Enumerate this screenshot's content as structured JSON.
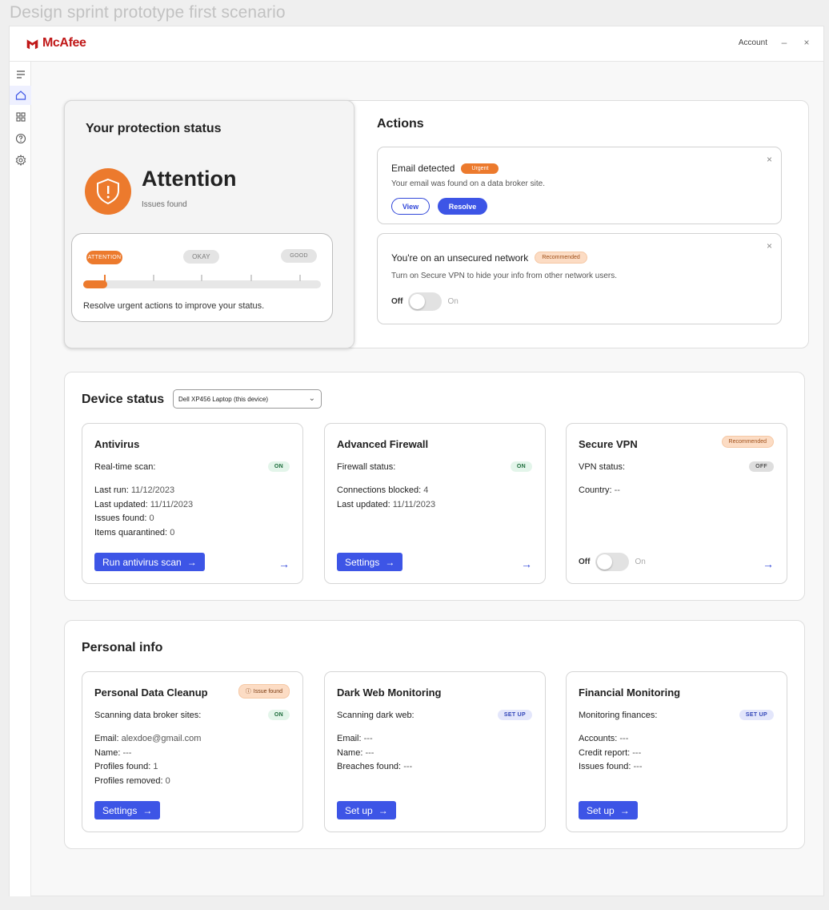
{
  "canvas_label": "Design sprint prototype first scenario",
  "titlebar": {
    "brand": "McAfee",
    "account": "Account",
    "minimize": "–",
    "close": "×"
  },
  "colors": {
    "brand": "#c01818",
    "accent": "#3d55e6",
    "attention": "#ec7a2d"
  },
  "protection": {
    "title": "Your protection status",
    "status": "Attention",
    "subtitle": "Issues found",
    "scale": {
      "labels": [
        "ATTENTION",
        "OKAY",
        "GOOD"
      ],
      "level_fraction": 0.1
    },
    "note": "Resolve urgent actions to improve your status."
  },
  "actions": {
    "title": "Actions",
    "items": [
      {
        "title": "Email detected",
        "badge": "Urgent",
        "desc": "Your email was found on a data broker site.",
        "view": "View",
        "resolve": "Resolve"
      },
      {
        "title": "You're on an unsecured network",
        "badge": "Recommended",
        "desc": "Turn on Secure VPN to hide your info from other network users.",
        "toggle_off": "Off",
        "toggle_on": "On"
      }
    ]
  },
  "device_status": {
    "title": "Device status",
    "selected_device": "Dell XP456 Laptop (this device)",
    "cards": [
      {
        "title": "Antivirus",
        "status_label": "Real-time scan:",
        "status": "ON",
        "lines": [
          {
            "k": "Last run:",
            "v": "11/12/2023"
          },
          {
            "k": "Last updated:",
            "v": "11/11/2023"
          },
          {
            "k": "Issues found:",
            "v": "0"
          },
          {
            "k": "Items quarantined:",
            "v": "0"
          }
        ],
        "button": "Run antivirus scan"
      },
      {
        "title": "Advanced Firewall",
        "status_label": "Firewall status:",
        "status": "ON",
        "lines": [
          {
            "k": "Connections blocked:",
            "v": "4"
          },
          {
            "k": "Last updated:",
            "v": "11/11/2023"
          }
        ],
        "button": "Settings"
      },
      {
        "title": "Secure VPN",
        "badge": "Recommended",
        "status_label": "VPN status:",
        "status": "OFF",
        "lines": [
          {
            "k": "Country:",
            "v": "--"
          }
        ],
        "toggle_off": "Off",
        "toggle_on": "On"
      }
    ]
  },
  "personal_info": {
    "title": "Personal info",
    "cards": [
      {
        "title": "Personal Data Cleanup",
        "badge": "Issue found",
        "status_label": "Scanning data broker sites:",
        "status": "ON",
        "lines": [
          {
            "k": "Email:",
            "v": "alexdoe@gmail.com"
          },
          {
            "k": "Name:",
            "v": "---"
          },
          {
            "k": "Profiles found:",
            "v": "1"
          },
          {
            "k": "Profiles removed:",
            "v": "0"
          }
        ],
        "button": "Settings"
      },
      {
        "title": "Dark Web Monitoring",
        "status_label": "Scanning dark web:",
        "status": "SET UP",
        "lines": [
          {
            "k": "Email:",
            "v": "---"
          },
          {
            "k": "Name:",
            "v": "---"
          },
          {
            "k": "Breaches found:",
            "v": "---"
          }
        ],
        "button": "Set up"
      },
      {
        "title": "Financial Monitoring",
        "status_label": "Monitoring finances:",
        "status": "SET UP",
        "lines": [
          {
            "k": "Accounts:",
            "v": "---"
          },
          {
            "k": "Credit report:",
            "v": "---"
          },
          {
            "k": "Issues found:",
            "v": "---"
          }
        ],
        "button": "Set up"
      }
    ]
  }
}
